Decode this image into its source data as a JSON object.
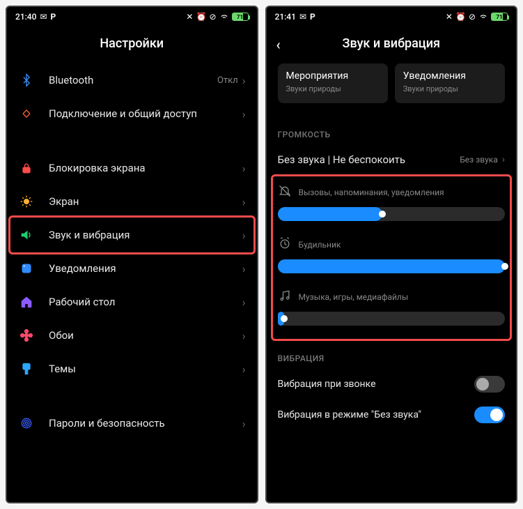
{
  "left": {
    "statusbar": {
      "time": "21:40",
      "battery": "71"
    },
    "title": "Настройки",
    "items": [
      {
        "icon": "bluetooth",
        "label": "Bluetooth",
        "value": "Откл",
        "color": "#3a90ff"
      },
      {
        "icon": "share",
        "label": "Подключение и общий доступ",
        "color": "#ff5f2f"
      },
      {
        "gap": true
      },
      {
        "icon": "lock",
        "label": "Блокировка экрана",
        "color": "#ff4b4b"
      },
      {
        "icon": "sun",
        "label": "Экран",
        "color": "#ffb02e"
      },
      {
        "icon": "sound",
        "label": "Звук и вибрация",
        "color": "#1dcf6f",
        "highlight": true
      },
      {
        "icon": "notif",
        "label": "Уведомления",
        "color": "#2e8cff"
      },
      {
        "icon": "home",
        "label": "Рабочий стол",
        "color": "#8a5cff"
      },
      {
        "icon": "flower",
        "label": "Обои",
        "color": "#ff4b6b"
      },
      {
        "icon": "brush",
        "label": "Темы",
        "color": "#2ea6ff"
      },
      {
        "gap": true
      },
      {
        "icon": "finger",
        "label": "Пароли и безопасность",
        "color": "#3a5cff"
      }
    ]
  },
  "right": {
    "statusbar": {
      "time": "21:41",
      "battery": "71"
    },
    "title": "Звук и вибрация",
    "cards": [
      {
        "title": "Мероприятия",
        "sub": "Звуки природы"
      },
      {
        "title": "Уведомления",
        "sub": "Звуки природы"
      }
    ],
    "volume_section": "ГРОМКОСТЬ",
    "silent": {
      "label": "Без звука | Не беспокоить",
      "value": "Без звука"
    },
    "sliders": [
      {
        "icon": "bell",
        "label": "Вызовы, напоминания, уведомления",
        "percent": 46
      },
      {
        "icon": "alarm",
        "label": "Будильник",
        "percent": 100
      },
      {
        "icon": "music",
        "label": "Музыка, игры, медиафайлы",
        "percent": 3
      }
    ],
    "vibration_section": "ВИБРАЦИЯ",
    "toggles": [
      {
        "label": "Вибрация при звонке",
        "on": false
      },
      {
        "label": "Вибрация в режиме \"Без звука\"",
        "on": true
      }
    ]
  }
}
